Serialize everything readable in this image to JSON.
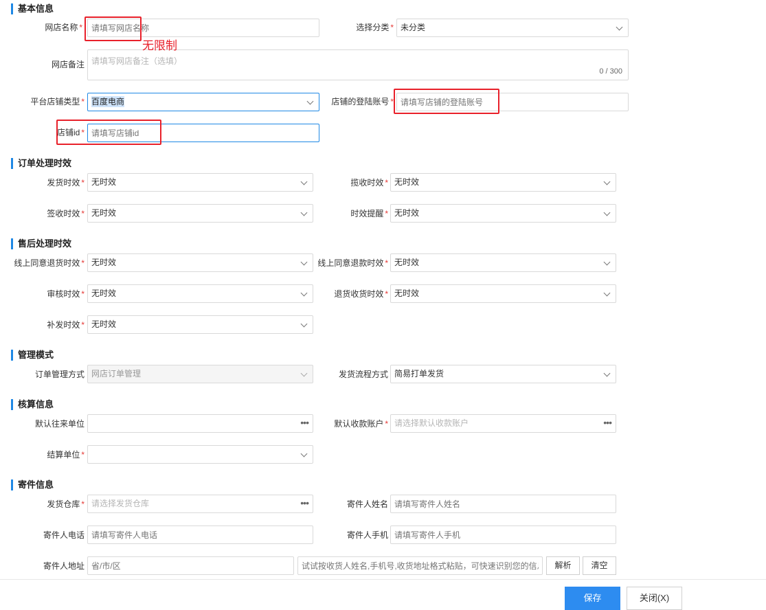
{
  "sections": {
    "basic": "基本信息",
    "order": "订单处理时效",
    "aftersale": "售后处理时效",
    "mgmt": "管理模式",
    "accounting": "核算信息",
    "sender": "寄件信息"
  },
  "basic": {
    "shop_name_label": "网店名称",
    "shop_name_placeholder": "请填写网店名称",
    "category_label": "选择分类",
    "category_value": "未分类",
    "remark_label": "网店备注",
    "remark_placeholder": "请填写网店备注（选填）",
    "remark_counter": "0 / 300",
    "platform_label": "平台店铺类型",
    "platform_value": "百度电商",
    "login_label": "店铺的登陆账号",
    "login_placeholder": "请填写店铺的登陆账号",
    "shopid_label": "店铺id",
    "shopid_placeholder": "请填写店铺id"
  },
  "annotation": {
    "text": "无限制",
    "color": "#e8202a"
  },
  "order": {
    "ship_label": "发货时效",
    "ship_value": "无时效",
    "pickup_label": "揽收时效",
    "pickup_value": "无时效",
    "sign_label": "签收时效",
    "sign_value": "无时效",
    "remind_label": "时效提醒",
    "remind_value": "无时效"
  },
  "aftersale": {
    "return_label": "线上同意退货时效",
    "return_value": "无时效",
    "refund_label": "线上同意退款时效",
    "refund_value": "无时效",
    "audit_label": "审核时效",
    "audit_value": "无时效",
    "receive_label": "退货收货时效",
    "receive_value": "无时效",
    "resend_label": "补发时效",
    "resend_value": "无时效"
  },
  "mgmt": {
    "order_mode_label": "订单管理方式",
    "order_mode_value": "网店订单管理",
    "ship_flow_label": "发货流程方式",
    "ship_flow_value": "简易打单发货"
  },
  "accounting": {
    "partner_label": "默认往来单位",
    "partner_value": "",
    "account_label": "默认收款账户",
    "account_placeholder": "请选择默认收款账户",
    "settle_label": "结算单位",
    "settle_value": ""
  },
  "sender": {
    "warehouse_label": "发货仓库",
    "warehouse_placeholder": "请选择发货仓库",
    "name_label": "寄件人姓名",
    "name_placeholder": "请填写寄件人姓名",
    "phone_label": "寄件人电话",
    "phone_placeholder": "请填写寄件人电话",
    "mobile_label": "寄件人手机",
    "mobile_placeholder": "请填写寄件人手机",
    "address_label": "寄件人地址",
    "region_placeholder": "省/市/区",
    "smart_placeholder": "试试按收货人姓名,手机号,收货地址格式粘贴，可快速识别您的信息",
    "parse_button": "解析",
    "clear_button": "清空"
  },
  "footer": {
    "save_button": "保存",
    "close_button": "关闭(X)"
  },
  "colors": {
    "accent": "#1e88e5",
    "primary_button": "#2d8cf0",
    "required": "#e53935"
  }
}
